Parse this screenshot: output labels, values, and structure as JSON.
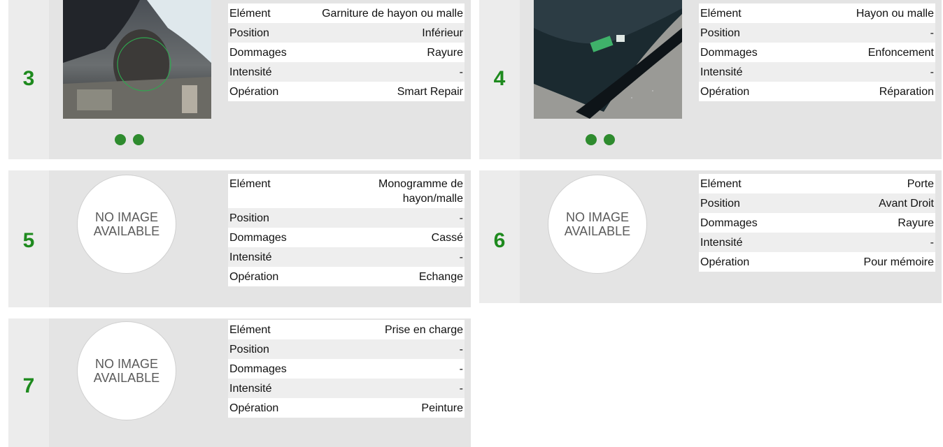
{
  "labels": {
    "element": "Elément",
    "position": "Position",
    "damages": "Dommages",
    "intensity": "Intensité",
    "operation": "Opération",
    "no_image_line1": "NO IMAGE",
    "no_image_line2": "AVAILABLE"
  },
  "cards": [
    {
      "number": "3",
      "element": "Garniture de hayon ou malle",
      "position": "Inférieur",
      "damages": "Rayure",
      "intensity": "-",
      "operation": "Smart Repair"
    },
    {
      "number": "4",
      "element": "Hayon ou malle",
      "position": "-",
      "damages": "Enfoncement",
      "intensity": "-",
      "operation": "Réparation"
    },
    {
      "number": "5",
      "element": "Monogramme de hayon/malle",
      "position": "-",
      "damages": "Cassé",
      "intensity": "-",
      "operation": "Echange"
    },
    {
      "number": "6",
      "element": "Porte",
      "position": "Avant Droit",
      "damages": "Rayure",
      "intensity": "-",
      "operation": "Pour mémoire"
    },
    {
      "number": "7",
      "element": "Prise en charge",
      "position": "-",
      "damages": "-",
      "intensity": "-",
      "operation": "Peinture"
    }
  ],
  "colors": {
    "accent_green": "#1e8a1e",
    "dot_green": "#2e8b2e",
    "card_bg": "#e4e4e4"
  }
}
